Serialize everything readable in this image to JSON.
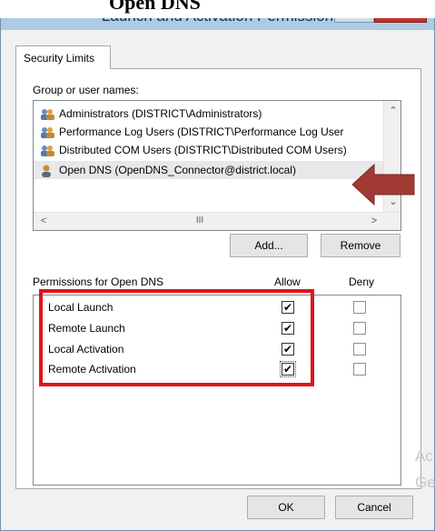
{
  "window": {
    "title": "Launch and Activation Permission",
    "help_label": "?",
    "close_label": "x"
  },
  "page_fragment": "Open DNS",
  "tab": {
    "label": "Security Limits"
  },
  "groups": {
    "heading": "Group or user names:",
    "items": [
      {
        "label": "Administrators (DISTRICT\\Administrators)",
        "icon": "group-icon"
      },
      {
        "label": "Performance Log Users (DISTRICT\\Performance Log User",
        "icon": "group-icon"
      },
      {
        "label": "Distributed COM Users (DISTRICT\\Distributed COM Users)",
        "icon": "group-icon"
      },
      {
        "label": "Open DNS (OpenDNS_Connector@district.local)",
        "icon": "user-icon",
        "selected": true
      }
    ],
    "hscroll_grip": "III",
    "add_label": "Add...",
    "remove_label": "Remove"
  },
  "permissions": {
    "heading": "Permissions for Open DNS",
    "allow_header": "Allow",
    "deny_header": "Deny",
    "rows": [
      {
        "name": "Local Launch",
        "allow": true,
        "deny": false
      },
      {
        "name": "Remote Launch",
        "allow": true,
        "deny": false
      },
      {
        "name": "Local Activation",
        "allow": true,
        "deny": false
      },
      {
        "name": "Remote Activation",
        "allow": true,
        "deny": false
      }
    ]
  },
  "footer": {
    "ok_label": "OK",
    "cancel_label": "Cancel"
  },
  "watermark": {
    "line1": "Ac",
    "line2": "Ge"
  },
  "colors": {
    "highlight": "#e0131a",
    "arrow": "#a23a34",
    "titlebar": "#aecbe4"
  }
}
